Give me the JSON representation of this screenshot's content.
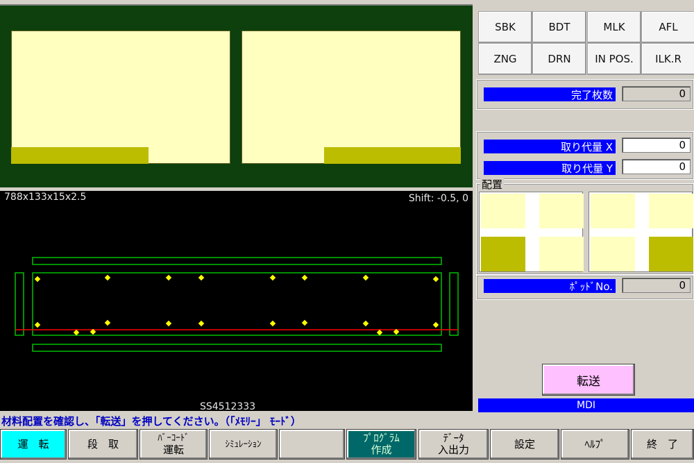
{
  "drawing": {
    "dimension_label": "788x133x15x2.5",
    "shift_label": "Shift: -0.5, 0",
    "material_label": "SS4512333"
  },
  "status_buttons": [
    {
      "label": "SBK"
    },
    {
      "label": "BDT"
    },
    {
      "label": "MLK"
    },
    {
      "label": "AFL"
    },
    {
      "label": "ZNG"
    },
    {
      "label": "DRN"
    },
    {
      "label": "IN POS."
    },
    {
      "label": "ILK.R"
    }
  ],
  "completed_count": {
    "label": "完了枚数",
    "value": "0"
  },
  "allowance_x": {
    "label": "取り代量 X",
    "value": "0"
  },
  "allowance_y": {
    "label": "取り代量 Y",
    "value": "0"
  },
  "layout": {
    "label": "配置"
  },
  "pot_no": {
    "label": "ﾎﾟｯﾄﾞNo.",
    "value": "0"
  },
  "transfer_button": {
    "label": "転送"
  },
  "mode_indicator": "MDI",
  "message": "材料配置を確認し、「転送」を押してください。（「ﾒﾓﾘｰ」 ﾓｰﾄﾞ）",
  "function_keys": [
    {
      "line1": "運　転",
      "line2": ""
    },
    {
      "line1": "段　取",
      "line2": ""
    },
    {
      "line1": "ﾊﾞｰｺｰﾄﾞ",
      "line2": "運転"
    },
    {
      "line1": "ｼﾐｭﾚｰｼｮﾝ",
      "line2": ""
    },
    {
      "line1": "",
      "line2": ""
    },
    {
      "line1": "ﾌﾟﾛｸﾞﾗﾑ",
      "line2": "作成"
    },
    {
      "line1": "ﾃﾞｰﾀ",
      "line2": "入出力"
    },
    {
      "line1": "設定",
      "line2": ""
    },
    {
      "line1": "ﾍﾙﾌﾟ",
      "line2": ""
    },
    {
      "line1": "終　了",
      "line2": ""
    }
  ],
  "colors": {
    "plate": "#ffffc0",
    "plate_strip": "#bcbc00",
    "label_blue": "#0000ff",
    "hole": "#ffff00",
    "outline": "#00c000",
    "datum_line": "#ff0000",
    "active_key": "#00ffff"
  }
}
